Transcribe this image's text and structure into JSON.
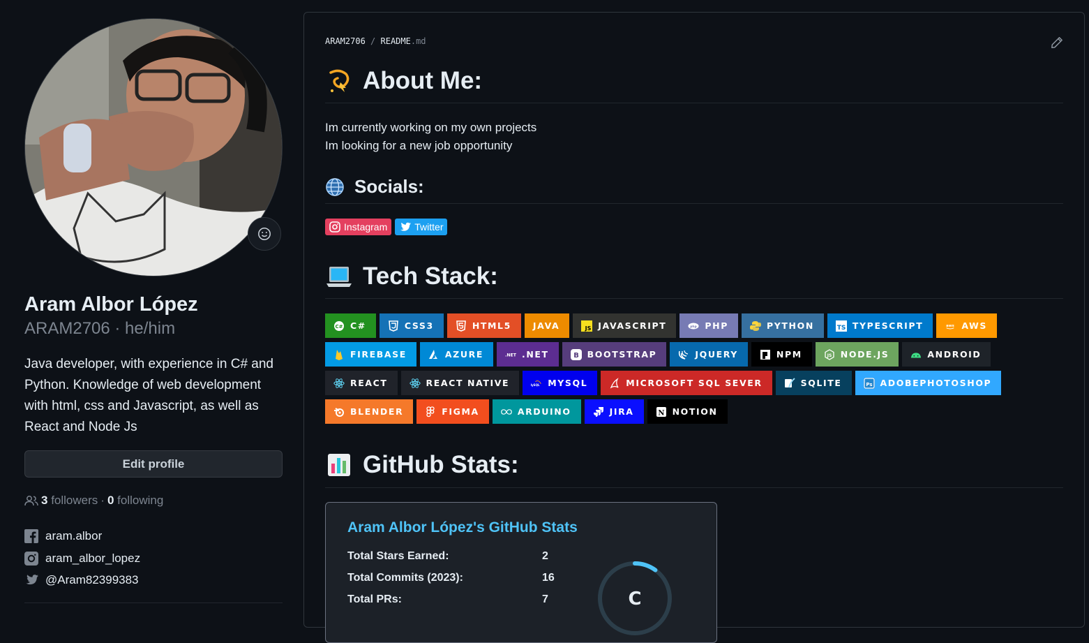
{
  "profile": {
    "name": "Aram Albor López",
    "login_pronouns": "ARAM2706 · he/him",
    "bio": "Java developer, with experience in C# and Python. Knowledge of web development with html, css and Javascript, as well as React and Node Js",
    "edit_button": "Edit profile",
    "followers_count": "3",
    "followers_label": "followers",
    "following_count": "0",
    "following_label": "following",
    "socials": [
      {
        "icon": "facebook-icon",
        "text": "aram.albor"
      },
      {
        "icon": "instagram-icon",
        "text": "aram_albor_lopez"
      },
      {
        "icon": "twitter-icon",
        "text": "@Aram82399383"
      }
    ]
  },
  "readme": {
    "breadcrumb_user": "ARAM2706",
    "breadcrumb_sep": "/",
    "breadcrumb_file": "README",
    "breadcrumb_ext": ".md",
    "about_heading": "About Me:",
    "about_lines": [
      "Im currently working on my own projects",
      "Im looking for a new job opportunity"
    ],
    "socials_heading": "Socials:",
    "social_badges": [
      {
        "label": "Instagram",
        "color": "#e4405f",
        "icon": "instagram-icon"
      },
      {
        "label": "Twitter",
        "color": "#1ca0f1",
        "icon": "twitter-bird-icon"
      }
    ],
    "tech_heading": "Tech Stack:",
    "tech_badges": [
      {
        "label": "C#",
        "color": "#239120",
        "icon": "csharp-icon"
      },
      {
        "label": "CSS3",
        "color": "#1572b6",
        "icon": "css3-icon"
      },
      {
        "label": "HTML5",
        "color": "#e34f26",
        "icon": "html5-icon"
      },
      {
        "label": "JAVA",
        "color": "#ed8b00",
        "icon": ""
      },
      {
        "label": "JAVASCRIPT",
        "color": "#323330",
        "icon": "javascript-icon"
      },
      {
        "label": "PHP",
        "color": "#777bb4",
        "icon": "php-icon"
      },
      {
        "label": "PYTHON",
        "color": "#3670a0",
        "icon": "python-icon"
      },
      {
        "label": "TYPESCRIPT",
        "color": "#007acc",
        "icon": "typescript-icon"
      },
      {
        "label": "AWS",
        "color": "#ff9900",
        "icon": "aws-icon"
      },
      {
        "label": "FIREBASE",
        "color": "#039be5",
        "icon": "firebase-icon"
      },
      {
        "label": "AZURE",
        "color": "#0089d6",
        "icon": "azure-icon"
      },
      {
        "label": ".NET",
        "color": "#5c2d91",
        "icon": "dotnet-icon"
      },
      {
        "label": "BOOTSTRAP",
        "color": "#563d7c",
        "icon": "bootstrap-icon"
      },
      {
        "label": "JQUERY",
        "color": "#0769ad",
        "icon": "jquery-icon"
      },
      {
        "label": "NPM",
        "color": "#000000",
        "icon": "npm-icon"
      },
      {
        "label": "NODE.JS",
        "color": "#6da55f",
        "icon": "nodejs-icon"
      },
      {
        "label": "ANDROID",
        "color": "#1e2329",
        "icon": "android-icon"
      },
      {
        "label": "REACT",
        "color": "#20232a",
        "icon": "react-icon"
      },
      {
        "label": "REACT NATIVE",
        "color": "#20232a",
        "icon": "react-icon"
      },
      {
        "label": "MYSQL",
        "color": "#0000ee",
        "icon": "mysql-icon"
      },
      {
        "label": "MICROSOFT SQL SEVER",
        "color": "#cc2927",
        "icon": "mssql-icon"
      },
      {
        "label": "SQLITE",
        "color": "#07405e",
        "icon": "sqlite-icon"
      },
      {
        "label": "ADOBEPHOTOSHOP",
        "color": "#31a8ff",
        "icon": "photoshop-icon"
      },
      {
        "label": "BLENDER",
        "color": "#f5792a",
        "icon": "blender-icon"
      },
      {
        "label": "FIGMA",
        "color": "#f24e1e",
        "icon": "figma-icon"
      },
      {
        "label": "ARDUINO",
        "color": "#00979d",
        "icon": "arduino-icon"
      },
      {
        "label": "JIRA",
        "color": "#0a0fff",
        "icon": "jira-icon"
      },
      {
        "label": "NOTION",
        "color": "#000000",
        "icon": "notion-icon"
      }
    ],
    "stats_heading": "GitHub Stats:",
    "stats_card": {
      "title": "Aram Albor López's GitHub Stats",
      "rows": [
        {
          "label": "Total Stars Earned:",
          "value": "2"
        },
        {
          "label": "Total Commits (2023):",
          "value": "16"
        },
        {
          "label": "Total PRs:",
          "value": "7"
        }
      ],
      "rank": "C",
      "rank_progress": 0.1
    }
  },
  "colors": {
    "background": "#0d1117",
    "border": "#30363d",
    "muted": "#7d8590",
    "stats_title": "#4fc3f7"
  }
}
